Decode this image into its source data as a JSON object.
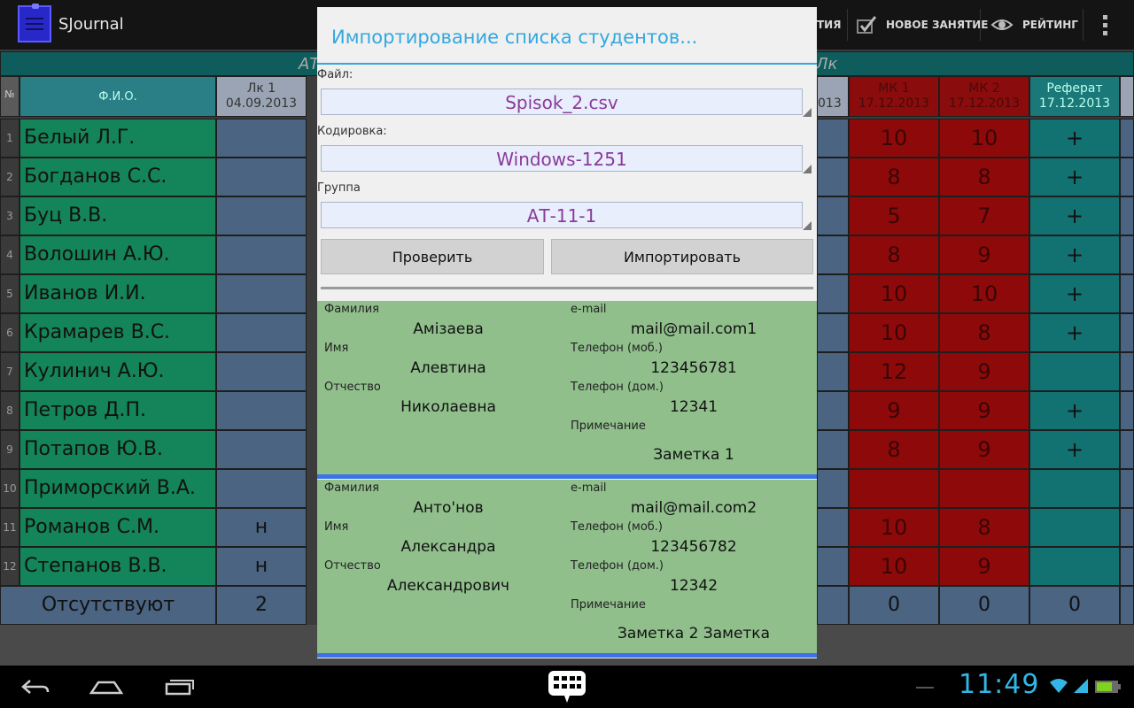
{
  "app": {
    "title": "SJournal"
  },
  "actionbar": {
    "partial_item": "ТИЯ",
    "new_lesson": "НОВОЕ ЗАНЯТИЕ",
    "rating": "РЕЙТИНГ"
  },
  "table": {
    "group_left": "АТ",
    "group_right": "Лк",
    "headers": {
      "num": "№",
      "fio": "Ф.И.О.",
      "lk1": "Лк 1",
      "lk1_date": "04.09.2013",
      "partial_date": "013",
      "mk1": "МК 1",
      "mk1_date": "17.12.2013",
      "mk2": "МК 2",
      "mk2_date": "17.12.2013",
      "ref": "Реферат",
      "ref_date": "17.12.2013"
    },
    "rows": [
      {
        "n": "1",
        "name": "Белый Л.Г.",
        "lk1": "",
        "mk1": "10",
        "mk2": "10",
        "ref": "+"
      },
      {
        "n": "2",
        "name": "Богданов С.С.",
        "lk1": "",
        "mk1": "8",
        "mk2": "8",
        "ref": "+"
      },
      {
        "n": "3",
        "name": "Буц В.В.",
        "lk1": "",
        "mk1": "5",
        "mk2": "7",
        "ref": "+"
      },
      {
        "n": "4",
        "name": "Волошин А.Ю.",
        "lk1": "",
        "mk1": "8",
        "mk2": "9",
        "ref": "+"
      },
      {
        "n": "5",
        "name": "Иванов И.И.",
        "lk1": "",
        "mk1": "10",
        "mk2": "10",
        "ref": "+"
      },
      {
        "n": "6",
        "name": "Крамарев В.С.",
        "lk1": "",
        "mk1": "10",
        "mk2": "8",
        "ref": "+"
      },
      {
        "n": "7",
        "name": "Кулинич А.Ю.",
        "lk1": "",
        "mk1": "12",
        "mk2": "9",
        "ref": ""
      },
      {
        "n": "8",
        "name": "Петров Д.П.",
        "lk1": "",
        "mk1": "9",
        "mk2": "9",
        "ref": "+"
      },
      {
        "n": "9",
        "name": "Потапов Ю.В.",
        "lk1": "",
        "mk1": "8",
        "mk2": "9",
        "ref": "+"
      },
      {
        "n": "10",
        "name": "Приморский В.А.",
        "lk1": "",
        "mk1": "",
        "mk2": "",
        "ref": ""
      },
      {
        "n": "11",
        "name": "Романов С.М.",
        "lk1": "н",
        "mk1": "10",
        "mk2": "8",
        "ref": ""
      },
      {
        "n": "12",
        "name": "Степанов В.В.",
        "lk1": "н",
        "mk1": "10",
        "mk2": "9",
        "ref": ""
      }
    ],
    "footer": {
      "label": "Отсутствуют",
      "lk1": "2",
      "mk1": "0",
      "mk2": "0",
      "ref": "0"
    }
  },
  "dialog": {
    "title": "Импортирование списка студентов...",
    "file_label": "Файл:",
    "file_value": "Spisok_2.csv",
    "encoding_label": "Кодировка:",
    "encoding_value": "Windows-1251",
    "group_label": "Группа",
    "group_value": "АТ-11-1",
    "check_button": "Проверить",
    "import_button": "Импортировать",
    "field_labels": {
      "surname": "Фамилия",
      "name": "Имя",
      "patronymic": "Отчество",
      "email": "e-mail",
      "phone_mob": "Телефон (моб.)",
      "phone_home": "Телефон (дом.)",
      "note": "Примечание"
    },
    "students": [
      {
        "surname": "Амізаева",
        "name": "Алевтина",
        "patronymic": "Николаевна",
        "email": "mail@mail.com1",
        "phone_mob": "123456781",
        "phone_home": "12341",
        "note": "Заметка 1"
      },
      {
        "surname": "Анто'нов",
        "name": "Александра",
        "patronymic": "Александрович",
        "email": "mail@mail.com2",
        "phone_mob": "123456782",
        "phone_home": "12342",
        "note": "Заметка 2 Заметка"
      }
    ]
  },
  "statusbar": {
    "time": "11:49"
  },
  "colors": {
    "accent": "#33a8e0",
    "card": "#90bf8c",
    "card_border": "#3a74e6",
    "name_col": "#14845a",
    "mark_col": "#8e0a0a",
    "ref_col": "#127272"
  },
  "icons": [
    "app-icon",
    "check-icon",
    "eye-icon",
    "overflow-menu-icon",
    "back-icon",
    "home-icon",
    "recent-apps-icon",
    "keyboard-icon",
    "wifi-icon",
    "signal-icon",
    "battery-icon"
  ]
}
